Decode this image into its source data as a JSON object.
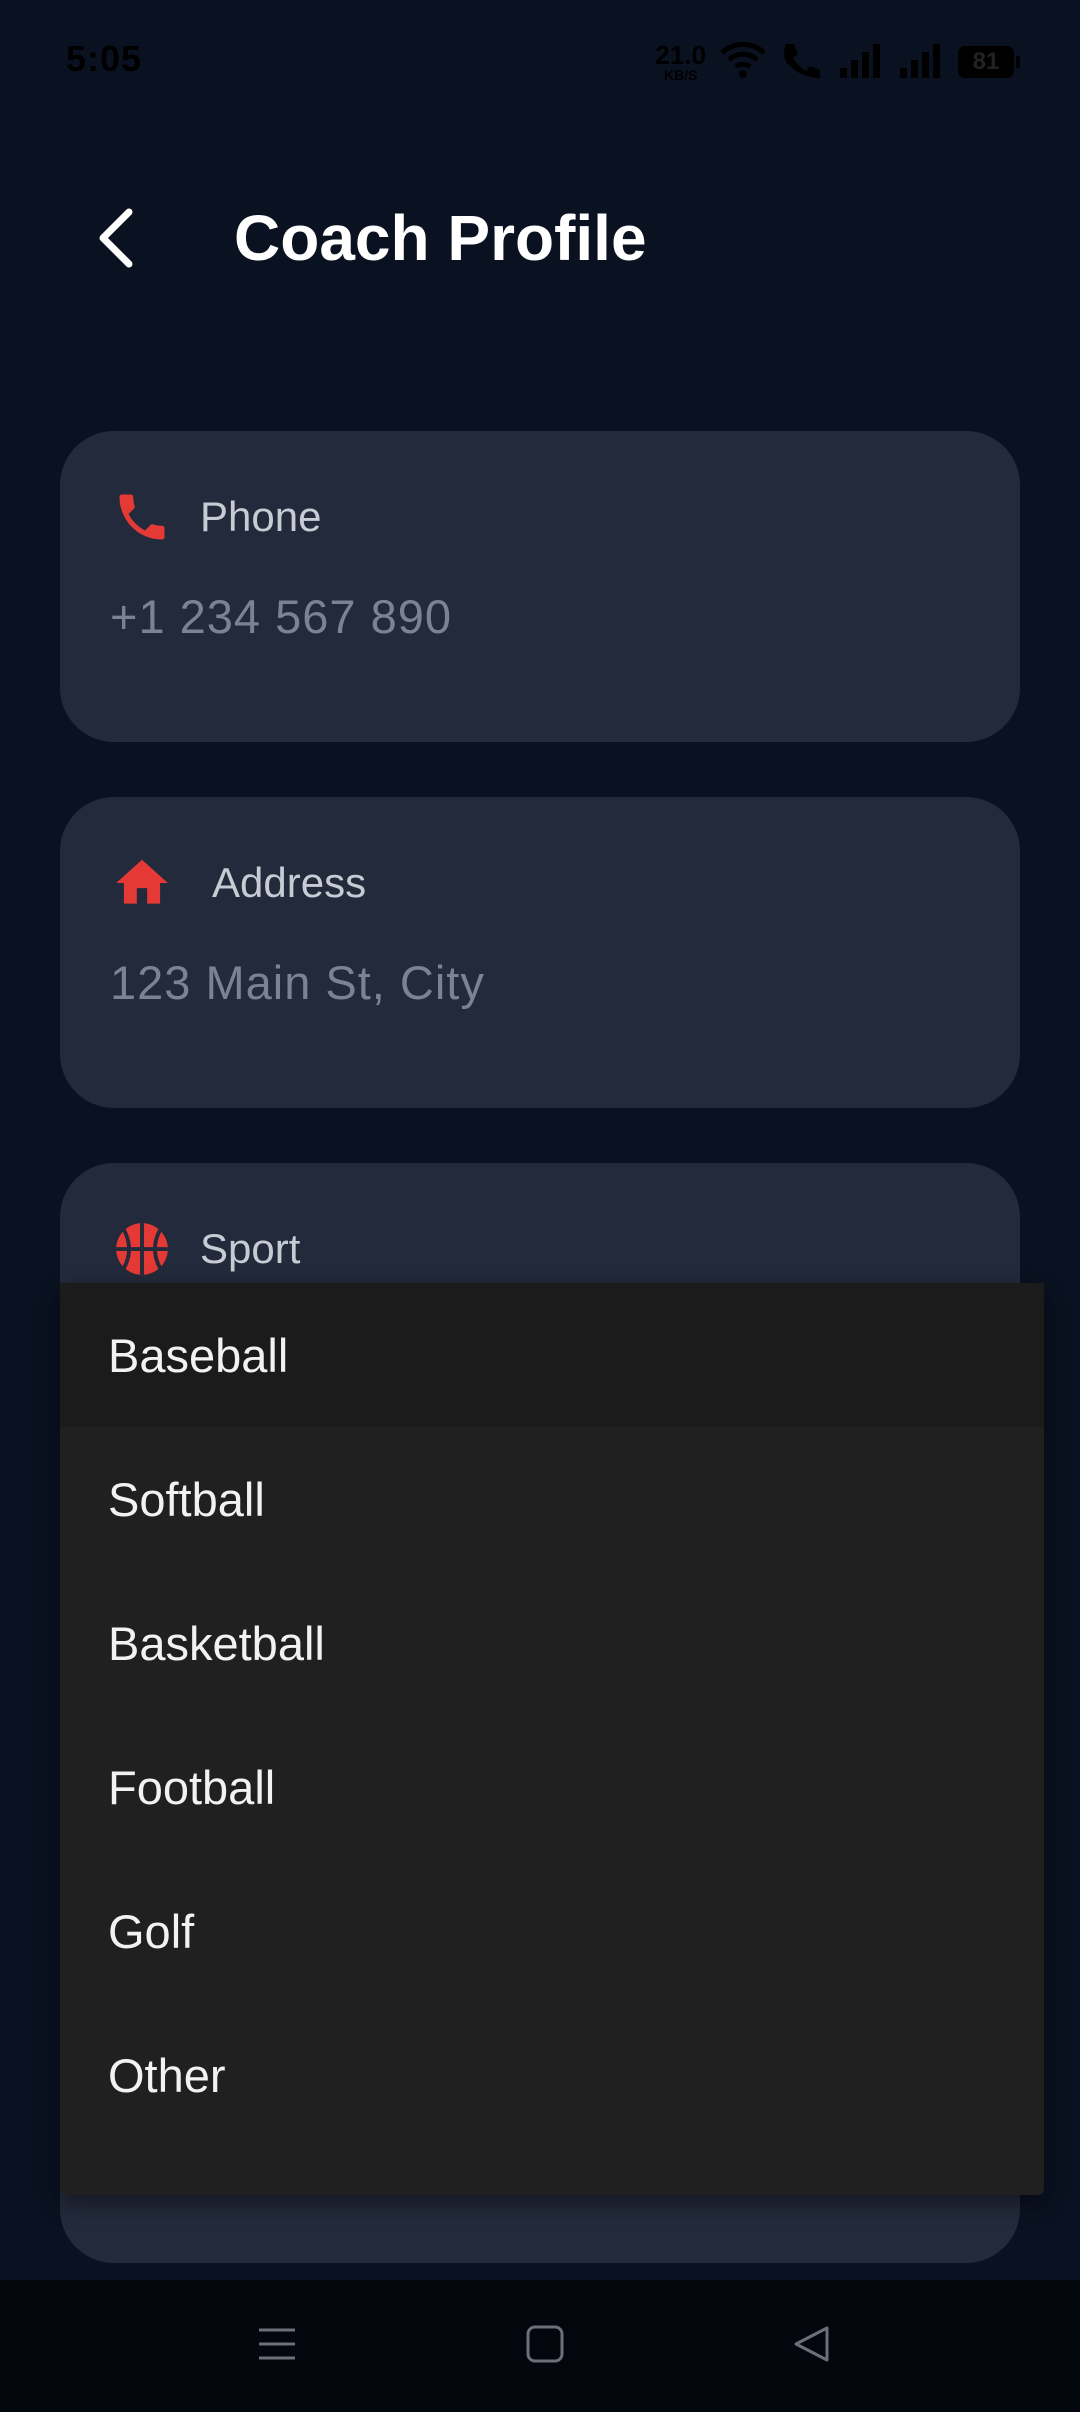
{
  "status_bar": {
    "time": "5:05",
    "net_speed_value": "21.0",
    "net_speed_unit": "KB/S",
    "battery_level": "81",
    "icons": [
      "wifi-icon",
      "volte-call-icon",
      "signal-icon",
      "signal-icon",
      "battery-icon"
    ]
  },
  "header": {
    "title": "Coach Profile",
    "back_icon": "chevron-left-icon"
  },
  "fields": {
    "phone": {
      "label": "Phone",
      "value": "+1 234 567 890",
      "icon": "phone-icon"
    },
    "address": {
      "label": "Address",
      "value": "123 Main St, City",
      "icon": "home-icon"
    },
    "sport": {
      "label": "Sport",
      "icon": "basketball-icon"
    }
  },
  "dropdown": {
    "selected": "Baseball",
    "options": [
      "Baseball",
      "Softball",
      "Basketball",
      "Football",
      "Golf",
      "Other"
    ]
  },
  "nav_bar": {
    "icons": [
      "menu-icon",
      "home-square-icon",
      "back-triangle-icon"
    ]
  },
  "colors": {
    "background": "#0a1120",
    "card": "#232a3b",
    "accent": "#e53935",
    "menu": "#202020"
  }
}
